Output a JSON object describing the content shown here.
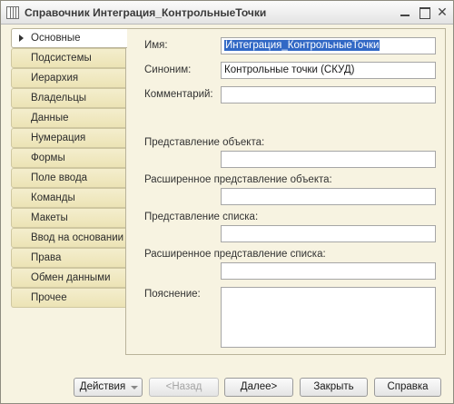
{
  "window": {
    "title": "Справочник Интеграция_КонтрольныеТочки"
  },
  "nav": {
    "items": [
      {
        "label": "Основные",
        "active": true
      },
      {
        "label": "Подсистемы",
        "active": false
      },
      {
        "label": "Иерархия",
        "active": false
      },
      {
        "label": "Владельцы",
        "active": false
      },
      {
        "label": "Данные",
        "active": false
      },
      {
        "label": "Нумерация",
        "active": false
      },
      {
        "label": "Формы",
        "active": false
      },
      {
        "label": "Поле ввода",
        "active": false
      },
      {
        "label": "Команды",
        "active": false
      },
      {
        "label": "Макеты",
        "active": false
      },
      {
        "label": "Ввод на основании",
        "active": false
      },
      {
        "label": "Права",
        "active": false
      },
      {
        "label": "Обмен данными",
        "active": false
      },
      {
        "label": "Прочее",
        "active": false
      }
    ]
  },
  "form": {
    "name_label": "Имя:",
    "name_value": "Интеграция_КонтрольныеТочки",
    "synonym_label": "Синоним:",
    "synonym_value": "Контрольные точки (СКУД)",
    "comment_label": "Комментарий:",
    "comment_value": "",
    "object_repr_label": "Представление объекта:",
    "object_repr_value": "",
    "ext_object_repr_label": "Расширенное представление объекта:",
    "ext_object_repr_value": "",
    "list_repr_label": "Представление списка:",
    "list_repr_value": "",
    "ext_list_repr_label": "Расширенное представление списка:",
    "ext_list_repr_value": "",
    "explanation_label": "Пояснение:",
    "explanation_value": ""
  },
  "buttons": {
    "actions": "Действия",
    "back": "<Назад",
    "next": "Далее>",
    "close": "Закрыть",
    "help": "Справка"
  }
}
